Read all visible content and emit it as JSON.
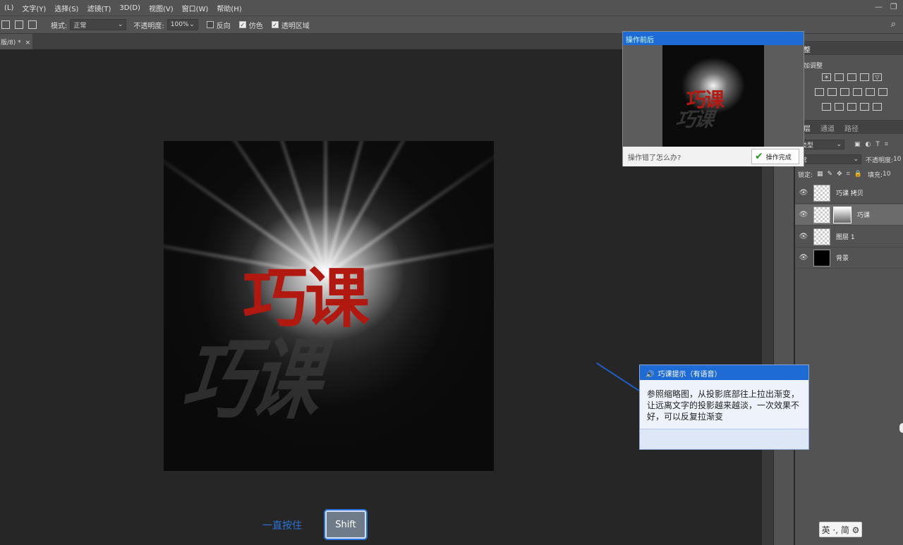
{
  "menu": [
    "(L)",
    "文字(Y)",
    "选择(S)",
    "滤镜(T)",
    "3D(D)",
    "视图(V)",
    "窗口(W)",
    "帮助(H)"
  ],
  "options": {
    "mode_label": "模式:",
    "mode_value": "正常",
    "opacity_label": "不透明度:",
    "opacity_value": "100%",
    "reverse_label": "反向",
    "dither_label": "仿色",
    "transparency_label": "透明区域"
  },
  "doc_tab": {
    "title": "版/8) *",
    "close": "×"
  },
  "artwork": {
    "main_text": "巧课",
    "shadow_text": "巧课"
  },
  "popup": {
    "title": "操作前后",
    "preview_text": "巧课",
    "question": "操作错了怎么办?",
    "done_label": "操作完成"
  },
  "panels": {
    "adjust_header": "整",
    "adjust_title": "加调整",
    "layers_tabs": [
      "层",
      "通道",
      "路径"
    ],
    "filter_value": "类型",
    "blend_value": "常",
    "opacity_label": "不透明度:",
    "opacity_value": "10",
    "lock_label": "锁定:",
    "fill_label": "填充:",
    "fill_value": "10",
    "layers": [
      {
        "name": "巧课 拷贝"
      },
      {
        "name": "巧课"
      },
      {
        "name": "图层 1"
      },
      {
        "name": "背景"
      }
    ]
  },
  "tip": {
    "title": "巧课提示（有语音）",
    "body": "参照缩略图，从投影底部往上拉出渐变，让远离文字的投影越来越淡，一次效果不好，可以反复拉渐变"
  },
  "hint": {
    "text": "一直按住",
    "key": "Shift"
  },
  "ime": "英 ·, 简 ⚙",
  "colors": {
    "accent": "#1e6bd6",
    "text_red": "#b01810"
  }
}
